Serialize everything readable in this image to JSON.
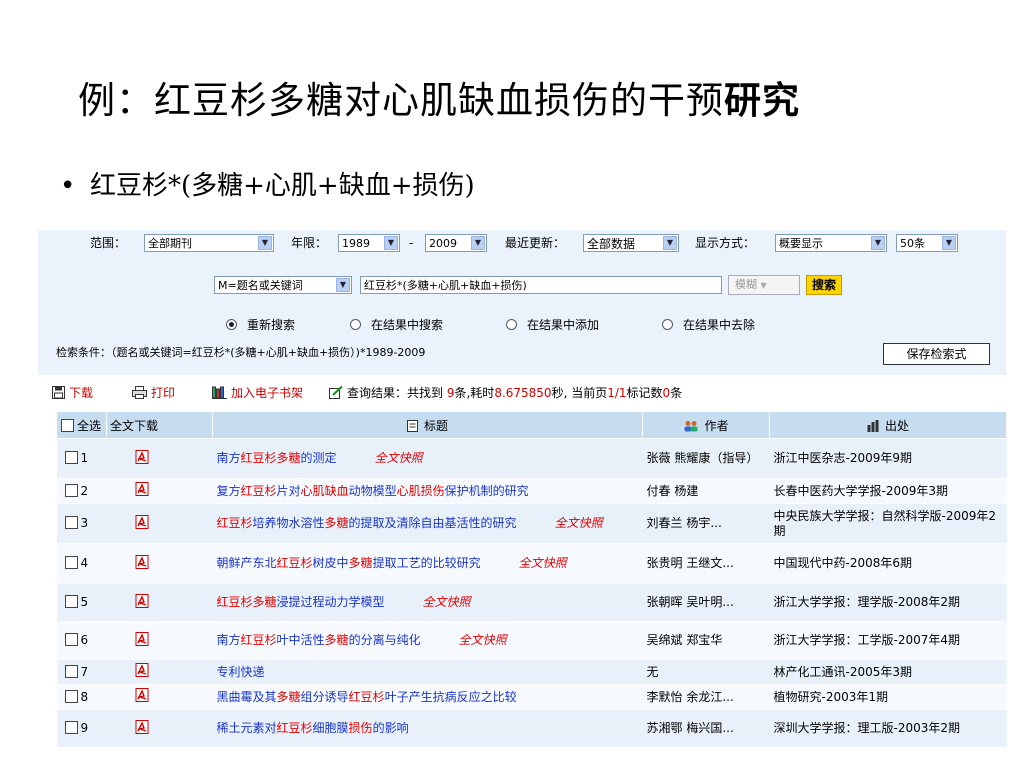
{
  "slide": {
    "title_main": "例：红豆杉多糖对心肌缺血损伤的干预",
    "title_bold": "研究",
    "bullet_char": "•",
    "bullet": "红豆杉*(多糖+心肌+缺血+损伤)"
  },
  "search": {
    "scope_label": "范围：",
    "scope_value": "全部期刊",
    "year_label": "年限：",
    "year_from": "1989",
    "year_sep": "-",
    "year_to": "2009",
    "update_label": "最近更新：",
    "update_value": "全部数据",
    "display_label": "显示方式：",
    "display_value": "概要显示",
    "count_value": "50条",
    "field_value": "M=题名或关键词",
    "query_value": "红豆杉*(多糖+心肌+缺血+损伤)",
    "match_value": "模糊",
    "search_button": "搜索",
    "radios": [
      "重新搜索",
      "在结果中搜索",
      "在结果中添加",
      "在结果中去除"
    ],
    "condition": "检索条件：（题名或关键词=红豆杉*(多糖+心肌+缺血+损伤）)*1989-2009",
    "save_button": "保存检索式"
  },
  "toolbar": {
    "download": "下载",
    "print": "打印",
    "add_bookshelf": "加入电子书架",
    "result_prefix": "查询结果：共找到",
    "found": "9",
    "found_unit": "条,耗时",
    "time": "8.675850",
    "time_unit": "秒, 当前页",
    "page": "1/1",
    "records_label": "标记数",
    "records": "0",
    "records_unit": "条"
  },
  "table": {
    "headers": {
      "select_all": "全选",
      "download": "全文下载",
      "title": "标题",
      "author": "作者",
      "source": "出处"
    },
    "full_text_label": "全文快照",
    "rows": [
      {
        "num": "1",
        "title": [
          {
            "t": "南方"
          },
          {
            "t": "红豆杉",
            "k": 1
          },
          {
            "t": "多糖",
            "k": 1
          },
          {
            "t": "的测定"
          }
        ],
        "full": true,
        "author": "张薇 熊耀康（指导）",
        "source": "浙江中医杂志-2009年9期"
      },
      {
        "num": "2",
        "title": [
          {
            "t": "复方"
          },
          {
            "t": "红豆杉",
            "k": 1
          },
          {
            "t": "片对"
          },
          {
            "t": "心肌",
            "k": 1
          },
          {
            "t": "缺血",
            "k": 1
          },
          {
            "t": "动物模型"
          },
          {
            "t": "心肌",
            "k": 1
          },
          {
            "t": "损伤",
            "k": 1
          },
          {
            "t": "保护机制的研究"
          }
        ],
        "full": false,
        "author": "付春 杨建",
        "source": "长春中医药大学学报-2009年3期"
      },
      {
        "num": "3",
        "title": [
          {
            "t": "红豆杉",
            "k": 1
          },
          {
            "t": "培养物水溶性"
          },
          {
            "t": "多糖",
            "k": 1
          },
          {
            "t": "的提取及清除自由基活性的研究"
          }
        ],
        "full": true,
        "author": "刘春兰 杨宇...",
        "source": "中央民族大学学报：自然科学版-2009年2期"
      },
      {
        "num": "4",
        "title": [
          {
            "t": "朝鲜产东北"
          },
          {
            "t": "红豆杉",
            "k": 1
          },
          {
            "t": "树皮中"
          },
          {
            "t": "多糖",
            "k": 1
          },
          {
            "t": "提取工艺的比较研究"
          }
        ],
        "full": true,
        "author": "张贵明 王继文...",
        "source": "中国现代中药-2008年6期"
      },
      {
        "num": "5",
        "title": [
          {
            "t": "红豆杉",
            "k": 1
          },
          {
            "t": "多糖",
            "k": 1
          },
          {
            "t": "浸提过程动力学模型"
          }
        ],
        "full": true,
        "author": "张朝晖 吴叶明...",
        "source": "浙江大学学报：理学版-2008年2期"
      },
      {
        "num": "6",
        "title": [
          {
            "t": "南方"
          },
          {
            "t": "红豆杉",
            "k": 1
          },
          {
            "t": "叶中活性"
          },
          {
            "t": "多糖",
            "k": 1
          },
          {
            "t": "的分离与纯化"
          }
        ],
        "full": true,
        "author": "吴绵斌 郑宝华",
        "source": "浙江大学学报：工学版-2007年4期"
      },
      {
        "num": "7",
        "title": [
          {
            "t": "专利快递"
          }
        ],
        "full": false,
        "author": "无",
        "source": "林产化工通讯-2005年3期"
      },
      {
        "num": "8",
        "title": [
          {
            "t": "黑曲霉及其"
          },
          {
            "t": "多糖",
            "k": 1
          },
          {
            "t": "组分诱导"
          },
          {
            "t": "红豆杉",
            "k": 1
          },
          {
            "t": "叶子产生抗病反应之比较"
          }
        ],
        "full": false,
        "author": "李默怡 余龙江...",
        "source": "植物研究-2003年1期"
      },
      {
        "num": "9",
        "title": [
          {
            "t": "稀土元素对"
          },
          {
            "t": "红豆杉",
            "k": 1
          },
          {
            "t": "细胞膜"
          },
          {
            "t": "损伤",
            "k": 1
          },
          {
            "t": "的影响"
          }
        ],
        "full": false,
        "author": "苏湘鄂 梅兴国...",
        "source": "深圳大学学报：理工版-2003年2期"
      }
    ]
  }
}
